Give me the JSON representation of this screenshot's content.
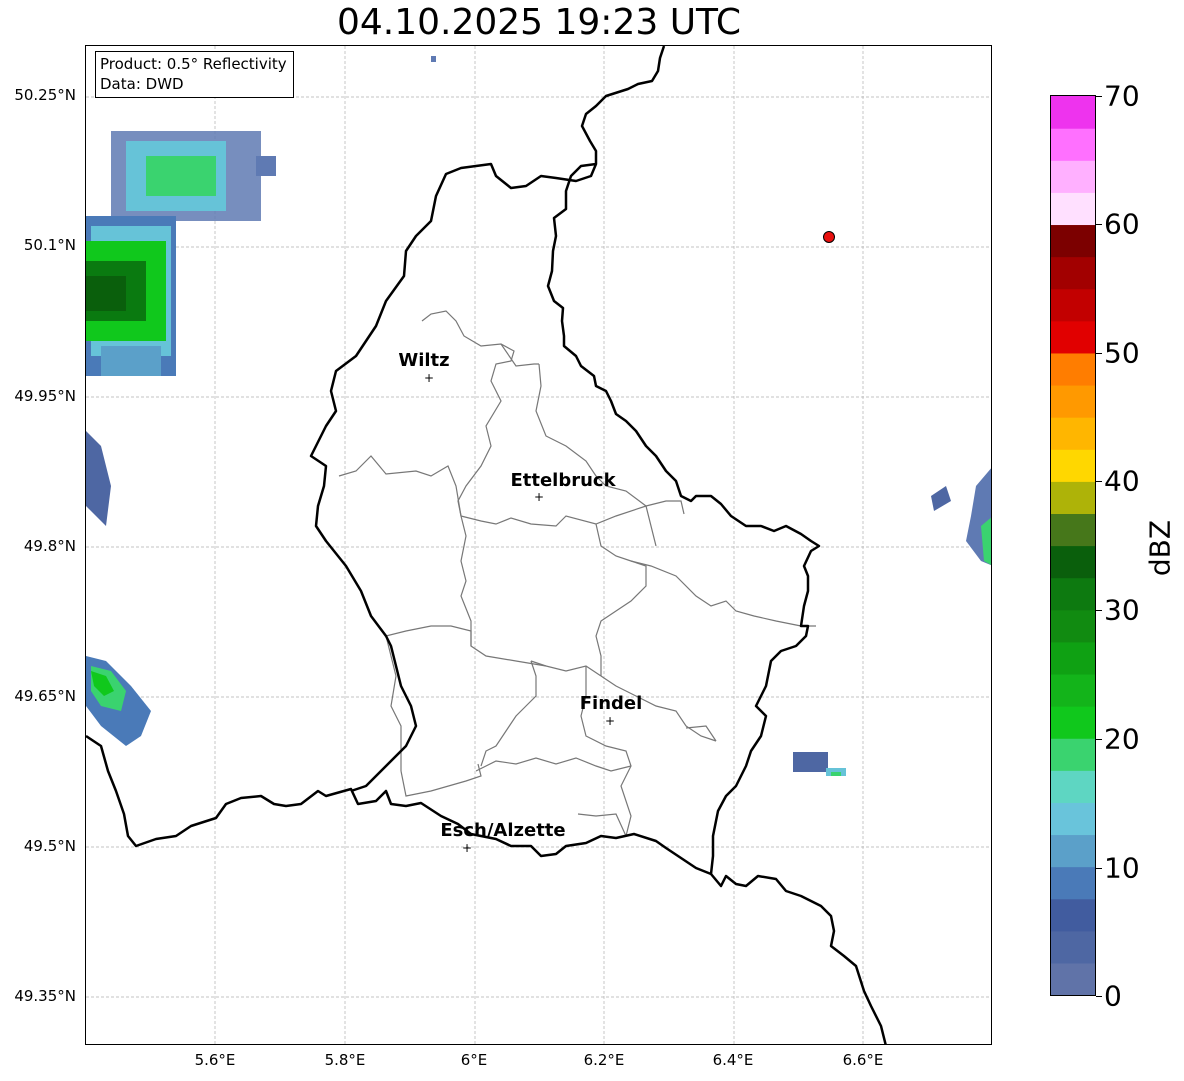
{
  "title": "04.10.2025 19:23 UTC",
  "info_box": {
    "product": "Product: 0.5° Reflectivity",
    "data_source": "Data: DWD"
  },
  "latitude_labels": [
    "50.25°N",
    "50.1°N",
    "49.95°N",
    "49.8°N",
    "49.65°N",
    "49.5°N",
    "49.35°N"
  ],
  "longitude_labels": [
    "5.6°E",
    "5.8°E",
    "6°E",
    "6.2°E",
    "6.4°E",
    "6.6°E"
  ],
  "cities": [
    {
      "name": "Wiltz",
      "lon": 5.93,
      "lat": 49.967
    },
    {
      "name": "Ettelbruck",
      "lon": 6.1,
      "lat": 49.847
    },
    {
      "name": "Findel",
      "lon": 6.21,
      "lat": 49.627
    },
    {
      "name": "Esch/Alzette",
      "lon": 5.99,
      "lat": 49.5
    }
  ],
  "radar_site_marker": {
    "lon": 6.548,
    "lat": 50.11,
    "color": "#e8100f"
  },
  "map_extent": {
    "lon_min": 5.4,
    "lon_max": 6.8,
    "lat_min": 49.3,
    "lat_max": 50.3
  },
  "colorbar": {
    "unit": "dBZ",
    "min": 0,
    "max": 70,
    "tick_labels": [
      "0",
      "10",
      "20",
      "30",
      "40",
      "50",
      "60",
      "70"
    ],
    "colors": [
      "#6073a8",
      "#4e67a3",
      "#415c9f",
      "#4a7ab8",
      "#5ba0c9",
      "#69c4db",
      "#5ed6c2",
      "#3ad36f",
      "#10c81c",
      "#13b41a",
      "#0fa113",
      "#118b11",
      "#0d7a10",
      "#0a5f0c",
      "#46771a",
      "#aeb308",
      "#ffd700",
      "#ffb600",
      "#ff9900",
      "#ff7d00",
      "#e10000",
      "#c20000",
      "#a20000",
      "#7c0000",
      "#ffe0ff",
      "#ffb0ff",
      "#ff70ff",
      "#ee33ee"
    ]
  }
}
